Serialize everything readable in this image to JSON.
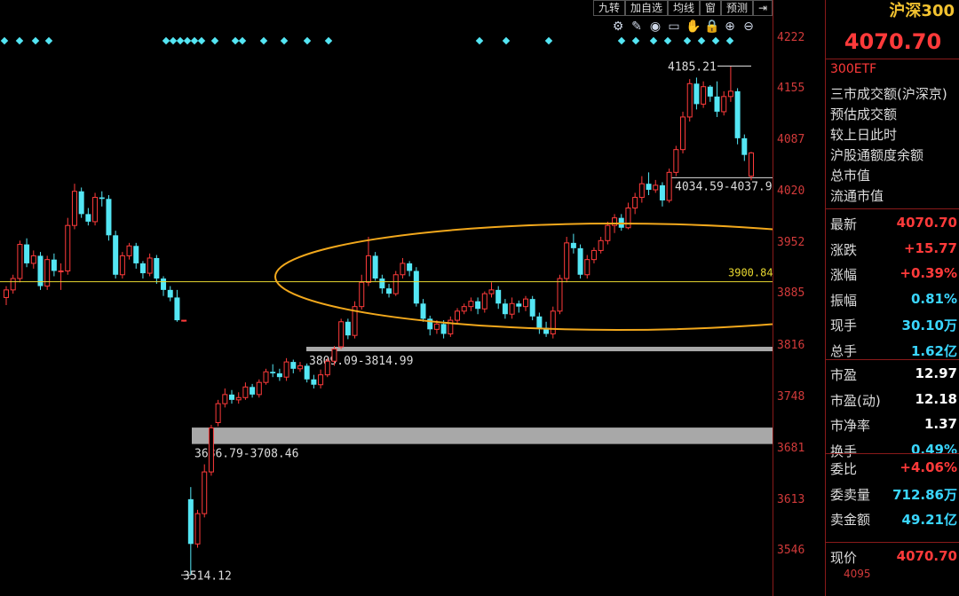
{
  "toolbar": {
    "buttons": [
      "九转",
      "加自选",
      "均线",
      "窗",
      "预测"
    ],
    "icons": [
      "settings-icon",
      "draw-icon",
      "eye-icon",
      "bag-icon",
      "hand-icon",
      "lock-icon",
      "zoom-in-icon",
      "zoom-out-icon"
    ]
  },
  "panel": {
    "name": "沪深300",
    "price": "4070.70",
    "etf": "300ETF",
    "info_items": [
      "三市成交额(沪深京)",
      "预估成交额",
      "较上日此时",
      "沪股通额度余额",
      "总市值",
      "流通市值"
    ],
    "stats_a": [
      {
        "label": "最新",
        "value": "4070.70",
        "color": "#ff3a3a"
      },
      {
        "label": "涨跌",
        "value": "+15.77",
        "color": "#ff3a3a"
      },
      {
        "label": "涨幅",
        "value": "+0.39%",
        "color": "#ff3a3a"
      },
      {
        "label": "振幅",
        "value": "0.81%",
        "color": "#3ad6ff"
      },
      {
        "label": "现手",
        "value": "30.10万",
        "color": "#3ad6ff"
      },
      {
        "label": "总手",
        "value": "1.62亿",
        "color": "#3ad6ff"
      }
    ],
    "stats_b": [
      {
        "label": "市盈",
        "value": "12.97",
        "color": "#ffffff"
      },
      {
        "label": "市盈(动)",
        "value": "12.18",
        "color": "#ffffff"
      },
      {
        "label": "市净率",
        "value": "1.37",
        "color": "#ffffff"
      },
      {
        "label": "换手",
        "value": "0.49%",
        "color": "#3ad6ff"
      }
    ],
    "stats_c": [
      {
        "label": "委比",
        "value": "+4.06%",
        "color": "#ff3a3a"
      },
      {
        "label": "委卖量",
        "value": "712.86万",
        "color": "#3ad6ff"
      },
      {
        "label": "卖金额",
        "value": "49.21亿",
        "color": "#3ad6ff"
      }
    ],
    "stats_d": [
      {
        "label": "现价",
        "value": "4070.70",
        "color": "#ff3a3a"
      }
    ],
    "bottom_tick": "4095"
  },
  "chart_data": {
    "type": "candlestick",
    "y_ticks": [
      4222,
      4155,
      4087,
      4020,
      3952,
      3885,
      3816,
      3748,
      3681,
      3613,
      3546
    ],
    "ylim": [
      3500,
      4260
    ],
    "hline": {
      "value": 3900.84,
      "label": "3900.84",
      "color": "#e8d830"
    },
    "gaps": [
      {
        "low": 3809.09,
        "high": 3814.99,
        "label": "3809.09-3814.99"
      },
      {
        "low": 3686.79,
        "high": 3708.46,
        "label": "3686.79-3708.46"
      },
      {
        "low": 4034.59,
        "high": 4037.9,
        "label": "4034.59-4037.9"
      }
    ],
    "annotations": [
      {
        "label": "4185.21",
        "value": 4185.21
      },
      {
        "label": "3514.12",
        "value": 3514.12
      }
    ],
    "candles": [
      [
        3880,
        3890,
        3870,
        3895
      ],
      [
        3890,
        3905,
        3885,
        3910
      ],
      [
        3905,
        3950,
        3900,
        3955
      ],
      [
        3950,
        3925,
        3920,
        3958
      ],
      [
        3925,
        3935,
        3918,
        3942
      ],
      [
        3935,
        3895,
        3890,
        3940
      ],
      [
        3895,
        3930,
        3890,
        3935
      ],
      [
        3930,
        3915,
        3908,
        3938
      ],
      [
        3915,
        3915,
        3890,
        3925
      ],
      [
        3915,
        3975,
        3910,
        3985
      ],
      [
        3975,
        4020,
        3970,
        4030
      ],
      [
        4020,
        3990,
        3985,
        4025
      ],
      [
        3990,
        3980,
        3975,
        3998
      ],
      [
        3980,
        4012,
        3975,
        4018
      ],
      [
        4012,
        4010,
        4000,
        4020
      ],
      [
        4010,
        3962,
        3955,
        4015
      ],
      [
        3962,
        3910,
        3905,
        3968
      ],
      [
        3910,
        3935,
        3905,
        3940
      ],
      [
        3935,
        3948,
        3930,
        3952
      ],
      [
        3948,
        3925,
        3918,
        3952
      ],
      [
        3925,
        3912,
        3905,
        3928
      ],
      [
        3912,
        3932,
        3908,
        3938
      ],
      [
        3932,
        3905,
        3898,
        3936
      ],
      [
        3905,
        3890,
        3882,
        3908
      ],
      [
        3890,
        3880,
        3875,
        3895
      ],
      [
        3880,
        3850,
        3848,
        3890
      ],
      [
        3850,
        3850,
        3848,
        3850
      ],
      [
        3614,
        3555,
        3514.12,
        3630
      ],
      [
        3555,
        3595,
        3550,
        3600
      ],
      [
        3595,
        3650,
        3590,
        3660
      ],
      [
        3650,
        3708,
        3645,
        3712
      ],
      [
        3715,
        3740,
        3710,
        3745
      ],
      [
        3740,
        3752,
        3735,
        3760
      ],
      [
        3752,
        3745,
        3740,
        3758
      ],
      [
        3745,
        3748,
        3740,
        3755
      ],
      [
        3748,
        3762,
        3745,
        3768
      ],
      [
        3762,
        3752,
        3748,
        3766
      ],
      [
        3752,
        3768,
        3748,
        3772
      ],
      [
        3768,
        3782,
        3765,
        3786
      ],
      [
        3782,
        3780,
        3775,
        3792
      ],
      [
        3780,
        3775,
        3770,
        3786
      ],
      [
        3775,
        3795,
        3770,
        3800
      ],
      [
        3795,
        3786,
        3780,
        3798
      ],
      [
        3786,
        3790,
        3782,
        3795
      ],
      [
        3790,
        3772,
        3768,
        3793
      ],
      [
        3772,
        3765,
        3760,
        3778
      ],
      [
        3765,
        3778,
        3760,
        3785
      ],
      [
        3778,
        3796,
        3775,
        3800
      ],
      [
        3796,
        3812,
        3790,
        3816
      ],
      [
        3815,
        3848,
        3812,
        3852
      ],
      [
        3848,
        3830,
        3825,
        3852
      ],
      [
        3830,
        3868,
        3826,
        3875
      ],
      [
        3868,
        3900,
        3864,
        3910
      ],
      [
        3900,
        3935,
        3895,
        3960
      ],
      [
        3935,
        3905,
        3902,
        3940
      ],
      [
        3905,
        3892,
        3885,
        3910
      ],
      [
        3892,
        3885,
        3880,
        3898
      ],
      [
        3885,
        3910,
        3882,
        3915
      ],
      [
        3910,
        3925,
        3905,
        3932
      ],
      [
        3925,
        3915,
        3908,
        3928
      ],
      [
        3915,
        3872,
        3868,
        3920
      ],
      [
        3872,
        3852,
        3848,
        3878
      ],
      [
        3852,
        3838,
        3830,
        3856
      ],
      [
        3838,
        3845,
        3832,
        3850
      ],
      [
        3845,
        3832,
        3826,
        3850
      ],
      [
        3832,
        3850,
        3828,
        3855
      ],
      [
        3850,
        3862,
        3845,
        3866
      ],
      [
        3862,
        3868,
        3858,
        3872
      ],
      [
        3868,
        3875,
        3862,
        3880
      ],
      [
        3875,
        3865,
        3858,
        3880
      ],
      [
        3865,
        3885,
        3860,
        3888
      ],
      [
        3885,
        3890,
        3880,
        3900
      ],
      [
        3890,
        3872,
        3865,
        3895
      ],
      [
        3872,
        3858,
        3852,
        3878
      ],
      [
        3858,
        3872,
        3852,
        3880
      ],
      [
        3872,
        3868,
        3860,
        3876
      ],
      [
        3868,
        3878,
        3862,
        3882
      ],
      [
        3878,
        3855,
        3850,
        3882
      ],
      [
        3855,
        3840,
        3832,
        3860
      ],
      [
        3840,
        3832,
        3828,
        3848
      ],
      [
        3832,
        3862,
        3826,
        3868
      ],
      [
        3862,
        3905,
        3858,
        3910
      ],
      [
        3905,
        3952,
        3900,
        3960
      ],
      [
        3952,
        3945,
        3938,
        3964
      ],
      [
        3945,
        3910,
        3905,
        3950
      ],
      [
        3910,
        3930,
        3905,
        3936
      ],
      [
        3930,
        3942,
        3925,
        3946
      ],
      [
        3942,
        3955,
        3938,
        3960
      ],
      [
        3955,
        3975,
        3950,
        3980
      ],
      [
        3975,
        3985,
        3965,
        3990
      ],
      [
        3985,
        3972,
        3968,
        3990
      ],
      [
        3972,
        3998,
        3970,
        4005
      ],
      [
        3998,
        4012,
        3990,
        4018
      ],
      [
        4012,
        4030,
        4005,
        4040
      ],
      [
        4030,
        4022,
        4015,
        4045
      ],
      [
        4022,
        4028,
        4018,
        4035
      ],
      [
        4028,
        4008,
        4000,
        4032
      ],
      [
        4008,
        4045,
        4005,
        4050
      ],
      [
        4045,
        4075,
        4040,
        4080
      ],
      [
        4075,
        4118,
        4070,
        4125
      ],
      [
        4118,
        4162,
        4112,
        4168
      ],
      [
        4162,
        4135,
        4128,
        4170
      ],
      [
        4135,
        4158,
        4130,
        4165
      ],
      [
        4158,
        4145,
        4138,
        4160
      ],
      [
        4145,
        4125,
        4118,
        4165
      ],
      [
        4125,
        4145,
        4120,
        4152
      ],
      [
        4145,
        4152,
        4138,
        4185.21
      ],
      [
        4152,
        4090,
        4082,
        4156
      ],
      [
        4090,
        4068,
        4060,
        4095
      ],
      [
        4040,
        4070.7,
        4034.59,
        4072
      ]
    ]
  }
}
